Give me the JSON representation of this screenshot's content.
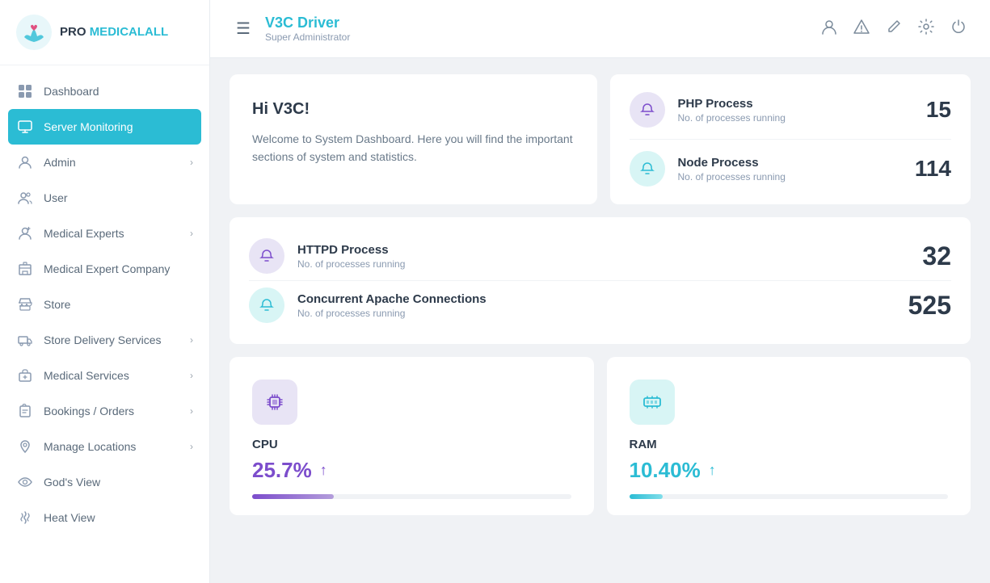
{
  "logo": {
    "text_bold": "PRO ",
    "text_colored": "MEDICALALL"
  },
  "sidebar": {
    "items": [
      {
        "id": "dashboard",
        "label": "Dashboard",
        "icon": "grid",
        "active": false,
        "hasChevron": false
      },
      {
        "id": "server-monitoring",
        "label": "Server Monitoring",
        "icon": "monitor",
        "active": true,
        "hasChevron": false
      },
      {
        "id": "admin",
        "label": "Admin",
        "icon": "person",
        "active": false,
        "hasChevron": true
      },
      {
        "id": "user",
        "label": "User",
        "icon": "person-group",
        "active": false,
        "hasChevron": false
      },
      {
        "id": "medical-experts",
        "label": "Medical Experts",
        "icon": "medical",
        "active": false,
        "hasChevron": true
      },
      {
        "id": "medical-expert-company",
        "label": "Medical Expert Company",
        "icon": "building",
        "active": false,
        "hasChevron": false
      },
      {
        "id": "store",
        "label": "Store",
        "icon": "store",
        "active": false,
        "hasChevron": false
      },
      {
        "id": "store-delivery",
        "label": "Store Delivery Services",
        "icon": "delivery",
        "active": false,
        "hasChevron": true
      },
      {
        "id": "medical-services",
        "label": "Medical Services",
        "icon": "medical-bag",
        "active": false,
        "hasChevron": true
      },
      {
        "id": "bookings",
        "label": "Bookings / Orders",
        "icon": "clipboard",
        "active": false,
        "hasChevron": true
      },
      {
        "id": "manage-locations",
        "label": "Manage Locations",
        "icon": "location",
        "active": false,
        "hasChevron": true
      },
      {
        "id": "gods-view",
        "label": "God's View",
        "icon": "eye",
        "active": false,
        "hasChevron": false
      },
      {
        "id": "heat-view",
        "label": "Heat View",
        "icon": "heat",
        "active": false,
        "hasChevron": false
      }
    ]
  },
  "header": {
    "title": "V3C Driver",
    "subtitle": "Super Administrator",
    "hamburger_label": "☰"
  },
  "welcome": {
    "greeting": "Hi V3C!",
    "message": "Welcome to System Dashboard. Here you will find the important sections of system and statistics."
  },
  "processes": {
    "php": {
      "name": "PHP Process",
      "sub": "No. of processes running",
      "count": "15"
    },
    "node": {
      "name": "Node Process",
      "sub": "No. of processes running",
      "count": "114"
    },
    "httpd": {
      "name": "HTTPD Process",
      "sub": "No. of processes running",
      "count": "32"
    },
    "apache": {
      "name": "Concurrent Apache Connections",
      "sub": "No. of processes running",
      "count": "525"
    }
  },
  "stats": {
    "cpu": {
      "label": "CPU",
      "value": "25.7%",
      "progress": 25.7
    },
    "ram": {
      "label": "RAM",
      "value": "10.40%",
      "progress": 10.4
    }
  }
}
